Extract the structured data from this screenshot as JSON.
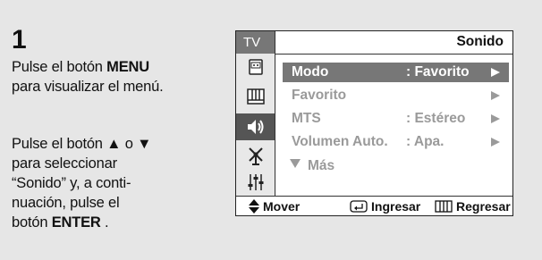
{
  "step": {
    "number": "1"
  },
  "instructions": {
    "p1_pre": "Pulse el botón ",
    "p1_bold": "MENU",
    "p1_post": "para visualizar el menú.",
    "p2_line1_pre": "Pulse el botón ",
    "p2_line1_mid": " o ",
    "p2_line2": "para seleccionar",
    "p2_line3": "“Sonido” y, a conti-",
    "p2_line4": "nuación, pulse el",
    "p2_line5_pre": "botón ",
    "p2_line5_bold": "ENTER",
    "p2_line5_post": " ."
  },
  "menu": {
    "tab_label": "TV",
    "section_title": "Sonido",
    "sidebar_icons": [
      "picture-icon",
      "channel-icon",
      "sound-icon",
      "antenna-icon",
      "setup-icon"
    ],
    "active_icon_index": 2,
    "items": [
      {
        "label": "Modo",
        "value": ": Favorito",
        "selected": true
      },
      {
        "label": "Favorito",
        "value": "",
        "selected": false
      },
      {
        "label": "MTS",
        "value": ": Estéreo",
        "selected": false
      },
      {
        "label": "Volumen Auto.",
        "value": ": Apa.",
        "selected": false
      }
    ],
    "more_label": "Más",
    "footer": {
      "move": "Mover",
      "enter": "Ingresar",
      "return": "Regresar"
    }
  }
}
